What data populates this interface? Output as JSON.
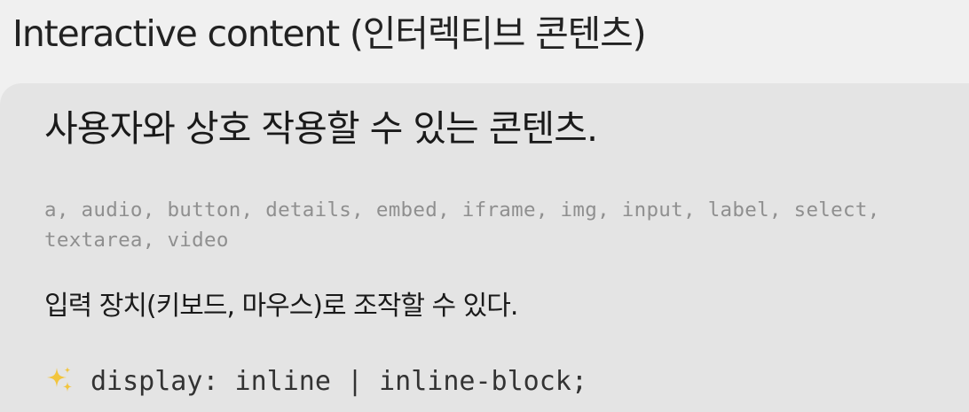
{
  "title": "Interactive content (인터렉티브 콘텐츠)",
  "card": {
    "heading": "사용자와 상호 작용할 수 있는 콘텐츠.",
    "element_list": "a, audio, button, details, embed, iframe, img, input, label, select, textarea, video",
    "description": "입력 장치(키보드, 마우스)로 조작할 수 있다.",
    "display_icon": "sparkles-icon",
    "display_value": "display: inline | inline-block;"
  },
  "colors": {
    "background": "#f0f0f0",
    "card_background": "#e4e4e4",
    "muted_text": "#8f8f8f",
    "sparkle": "#f2c53d"
  }
}
